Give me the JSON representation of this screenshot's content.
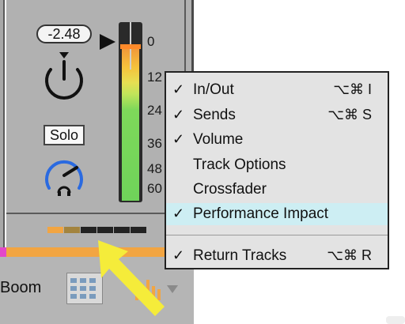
{
  "mixer": {
    "volume_value": "-2.48",
    "solo_label": "Solo",
    "scale_labels": [
      "0",
      "12",
      "24",
      "36",
      "48",
      "60"
    ],
    "performance_level": 0.33
  },
  "device": {
    "name": "Boom"
  },
  "context_menu": {
    "items": [
      {
        "checked": true,
        "check": "✓",
        "label": "In/Out",
        "shortcut": "⌥⌘ I"
      },
      {
        "checked": true,
        "check": "✓",
        "label": "Sends",
        "shortcut": "⌥⌘ S"
      },
      {
        "checked": true,
        "check": "✓",
        "label": "Volume",
        "shortcut": ""
      },
      {
        "checked": false,
        "check": "",
        "label": "Track Options",
        "shortcut": ""
      },
      {
        "checked": false,
        "check": "",
        "label": "Crossfader",
        "shortcut": ""
      },
      {
        "checked": true,
        "check": "✓",
        "label": "Performance Impact",
        "shortcut": "",
        "highlighted": true
      },
      {
        "checked": true,
        "check": "✓",
        "label": "Return Tracks",
        "shortcut": "⌥⌘ R"
      }
    ]
  },
  "colors": {
    "accent_orange": "#f2a542",
    "meter_green": "#6fd35a",
    "highlight": "#cdeef3",
    "annotation_arrow": "#f5ec3a"
  }
}
